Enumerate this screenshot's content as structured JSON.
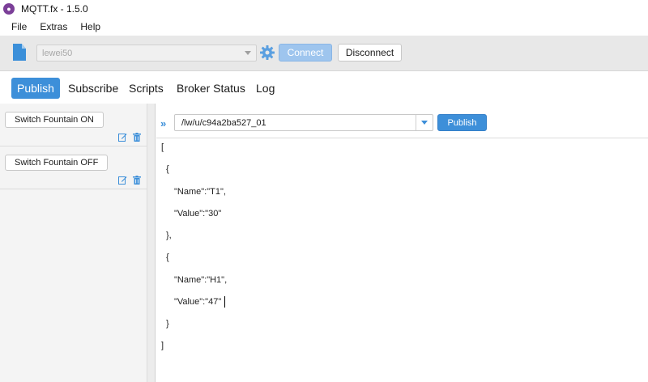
{
  "window": {
    "title": "MQTT.fx - 1.5.0",
    "app_icon": "mqttfx-logo-icon",
    "accent_color": "#3d8fd9"
  },
  "menubar": {
    "items": [
      "File",
      "Extras",
      "Help"
    ]
  },
  "connection": {
    "profile_value": "lewei50",
    "connect_label": "Connect",
    "disconnect_label": "Disconnect",
    "connect_enabled": false
  },
  "tabs": [
    {
      "label": "Publish",
      "active": true
    },
    {
      "label": "Subscribe",
      "active": false
    },
    {
      "label": "Scripts",
      "active": false
    },
    {
      "label": "Broker Status",
      "active": false
    },
    {
      "label": "Log",
      "active": false
    }
  ],
  "scripts": [
    {
      "label": "Switch Fountain ON"
    },
    {
      "label": "Switch Fountain OFF"
    }
  ],
  "publish": {
    "topic": "/lw/u/c94a2ba527_01",
    "publish_label": "Publish",
    "chevron": "»"
  },
  "payload": {
    "lines": [
      "[",
      "  {",
      "      \"Name\":\"T1\",",
      "      \"Value\":\"30\"",
      "  },",
      "  {",
      "      \"Name\":\"H1\",",
      "      \"Value\":\"47\"",
      "  }",
      "]"
    ]
  }
}
